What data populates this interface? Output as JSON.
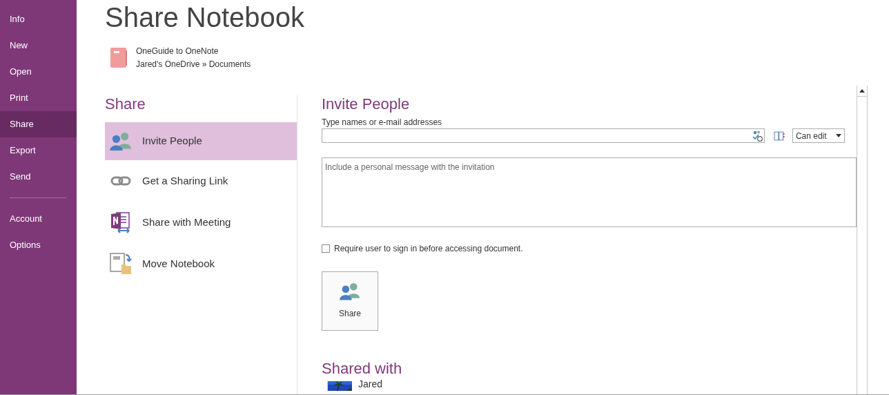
{
  "sidebar": {
    "groups": [
      [
        {
          "label": "Info",
          "selected": false
        },
        {
          "label": "New",
          "selected": false
        },
        {
          "label": "Open",
          "selected": false
        },
        {
          "label": "Print",
          "selected": false
        },
        {
          "label": "Share",
          "selected": true
        },
        {
          "label": "Export",
          "selected": false
        },
        {
          "label": "Send",
          "selected": false
        }
      ],
      [
        {
          "label": "Account",
          "selected": false
        },
        {
          "label": "Options",
          "selected": false
        }
      ]
    ]
  },
  "title": "Share Notebook",
  "notebook": {
    "name": "OneGuide to OneNote",
    "location": "Jared's OneDrive » Documents"
  },
  "share_heading": "Share",
  "share_options": [
    {
      "kind": "invite",
      "label": "Invite People",
      "selected": true
    },
    {
      "kind": "link",
      "label": "Get a Sharing Link",
      "selected": false
    },
    {
      "kind": "meeting",
      "label": "Share with Meeting",
      "selected": false
    },
    {
      "kind": "move",
      "label": "Move Notebook",
      "selected": false
    }
  ],
  "invite": {
    "heading": "Invite People",
    "names_label": "Type names or e-mail addresses",
    "permission": "Can edit",
    "message_placeholder": "Include a personal message with the invitation",
    "require_sign_in": {
      "label": "Require user to sign in before accessing document.",
      "checked": false
    },
    "share_button": "Share"
  },
  "shared_with": {
    "heading": "Shared with",
    "people": [
      {
        "name": "Jared",
        "kind": "picture"
      }
    ]
  }
}
